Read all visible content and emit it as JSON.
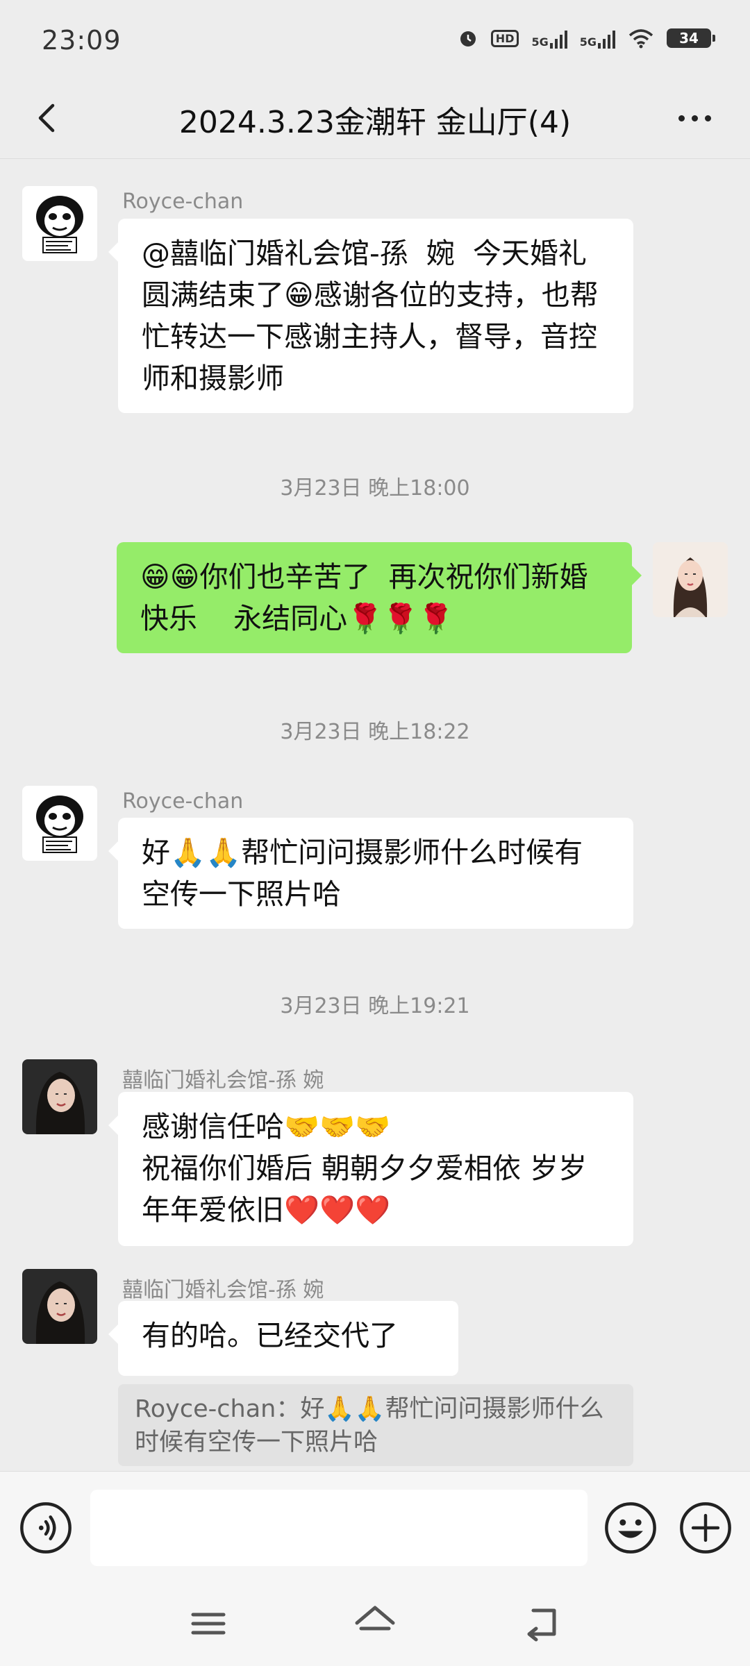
{
  "status": {
    "time": "23:09",
    "hd": "HD",
    "net1": "5G",
    "net2": "5G",
    "battery": "34"
  },
  "header": {
    "title": "2024.3.23金潮轩 金山厅(4)"
  },
  "messages": [
    {
      "sender": "Royce-chan",
      "text": "@囍临门婚礼会馆-孫  婉  今天婚礼圆满结束了😁感谢各位的支持，也帮忙转达一下感谢主持人，督导，音控师和摄影师"
    },
    {
      "timestamp": "3月23日 晚上18:00"
    },
    {
      "sender": "",
      "text": "😁😁你们也辛苦了  再次祝你们新婚快乐    永结同心🌹🌹🌹"
    },
    {
      "timestamp": "3月23日 晚上18:22"
    },
    {
      "sender": "Royce-chan",
      "text": "好🙏🙏帮忙问问摄影师什么时候有空传一下照片哈"
    },
    {
      "timestamp": "3月23日 晚上19:21"
    },
    {
      "sender": "囍临门婚礼会馆-孫  婉",
      "text": "感谢信任哈🤝🤝🤝\n祝福你们婚后 朝朝夕夕爱相依 岁岁年年爱依旧❤️❤️❤️"
    },
    {
      "sender": "囍临门婚礼会馆-孫  婉",
      "text": "有的哈。已经交代了",
      "quote": "Royce-chan：好🙏🙏帮忙问问摄影师什么时候有空传一下照片哈"
    }
  ],
  "input": {
    "placeholder": ""
  },
  "icons": {
    "back": "back-arrow-icon",
    "more": "more-dots-icon",
    "voice": "voice-icon",
    "emoji": "emoji-icon",
    "plus": "plus-icon",
    "menu": "menu-icon",
    "home": "home-icon",
    "return": "return-icon"
  },
  "colors": {
    "background": "#ededed",
    "own_bubble": "#95ec69",
    "other_bubble": "#ffffff"
  }
}
